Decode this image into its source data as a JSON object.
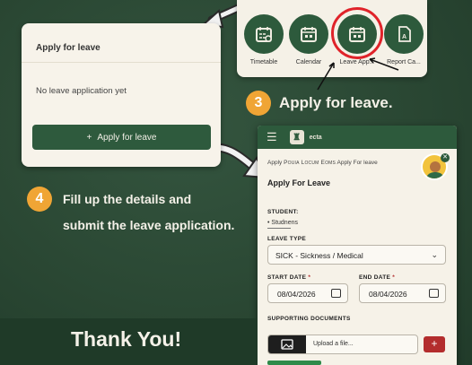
{
  "card1": {
    "title": "Apply for leave",
    "empty_text": "No leave application yet",
    "button_label": "Apply for leave",
    "button_icon": "+"
  },
  "icons": [
    {
      "label": "Timetable",
      "icon": "calendar-grid-icon"
    },
    {
      "label": "Calendar",
      "icon": "calendar-icon"
    },
    {
      "label": "Leave App...",
      "icon": "leave-calendar-icon"
    },
    {
      "label": "Report Ca...",
      "icon": "report-card-icon"
    }
  ],
  "steps": [
    {
      "number": "3",
      "text": "Apply for leave."
    },
    {
      "number": "4",
      "line1": "Fill up the details and",
      "line2": "submit the leave application."
    }
  ],
  "phone": {
    "brand": "ecta",
    "breadcrumb": {
      "part1": "Apply",
      "part2": "Pouia Locum Eoms",
      "part3": "Apply For leave"
    },
    "page_title": "Apply For Leave",
    "student_label": "STUDENT:",
    "student_value": "Studnens",
    "leave_type_label": "LEAVE TYPE",
    "leave_type_value": "SICK - Sickness / Medical",
    "start_label": "START DATE",
    "start_value": "08/04/2026",
    "end_label": "END DATE",
    "end_value": "08/04/2026",
    "docs_label": "SUPPORTING DOCUMENTS",
    "upload_text": "Upload a file..."
  },
  "footer": {
    "thanks": "Thank You!"
  },
  "colors": {
    "accent_green": "#2d5a3c",
    "badge_orange": "#f0a535",
    "highlight_red": "#e0232a",
    "add_red": "#b32d2d"
  }
}
